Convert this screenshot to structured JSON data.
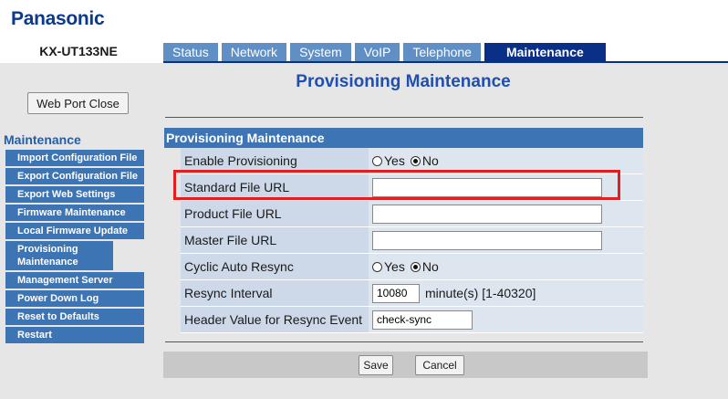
{
  "brand": "Panasonic",
  "model": "KX-UT133NE",
  "tabs": [
    {
      "label": "Status"
    },
    {
      "label": "Network"
    },
    {
      "label": "System"
    },
    {
      "label": "VoIP"
    },
    {
      "label": "Telephone"
    },
    {
      "label": "Maintenance",
      "active": true
    }
  ],
  "sidebar": {
    "web_port_close": "Web Port Close",
    "title": "Maintenance",
    "items": [
      {
        "label": "Import Configuration File"
      },
      {
        "label": "Export Configuration File"
      },
      {
        "label": "Export Web Settings"
      },
      {
        "label": "Firmware Maintenance"
      },
      {
        "label": "Local Firmware Update"
      },
      {
        "label": "Provisioning Maintenance"
      },
      {
        "label": "Management Server"
      },
      {
        "label": "Power Down Log"
      },
      {
        "label": "Reset to Defaults"
      },
      {
        "label": "Restart"
      }
    ]
  },
  "main": {
    "page_title": "Provisioning Maintenance",
    "section_title": "Provisioning Maintenance",
    "rows": {
      "enable_provisioning": {
        "label": "Enable Provisioning",
        "yes": "Yes",
        "no": "No",
        "selected": "No"
      },
      "standard_file_url": {
        "label": "Standard File URL",
        "value": ""
      },
      "product_file_url": {
        "label": "Product File URL",
        "value": ""
      },
      "master_file_url": {
        "label": "Master File URL",
        "value": ""
      },
      "cyclic_auto_resync": {
        "label": "Cyclic Auto Resync",
        "yes": "Yes",
        "no": "No",
        "selected": "No"
      },
      "resync_interval": {
        "label": "Resync Interval",
        "value": "10080",
        "unit": "minute(s) [1-40320]"
      },
      "header_value": {
        "label": "Header Value for Resync Event",
        "value": "check-sync"
      }
    },
    "buttons": {
      "save": "Save",
      "cancel": "Cancel"
    }
  },
  "colors": {
    "accent": "#0a2f86",
    "tab": "#5f8fc4",
    "menu": "#3d74b3",
    "highlight": "#e02020"
  }
}
